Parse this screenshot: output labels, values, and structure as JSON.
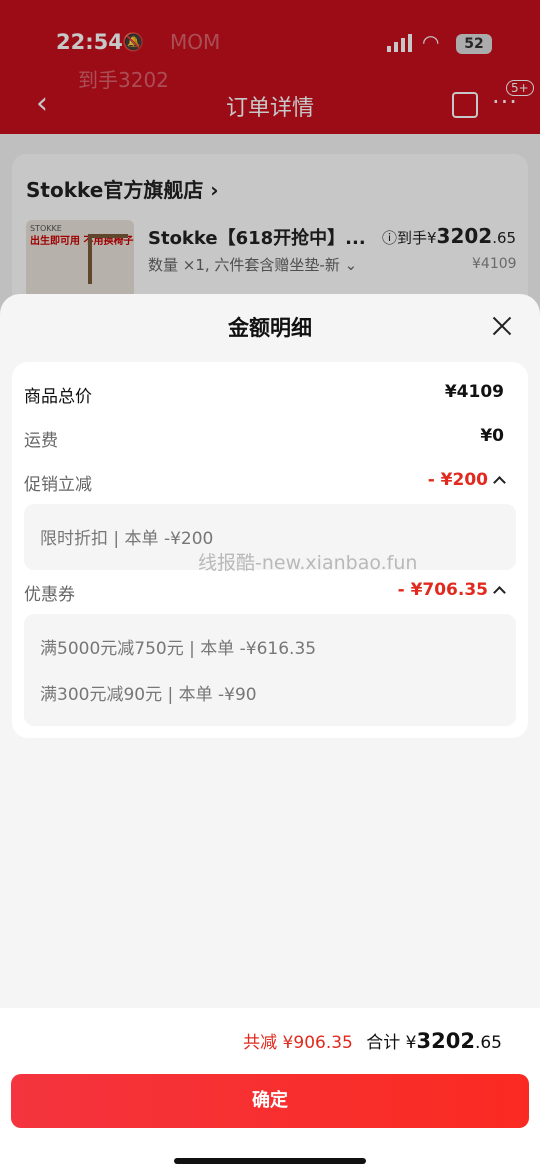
{
  "status_bar": {
    "time": "22:54",
    "battery": "52"
  },
  "nav": {
    "title": "订单详情",
    "badge": "5+",
    "bg_text_1": "MOM",
    "bg_text_2": "到手3202"
  },
  "order": {
    "store_name": "Stokke官方旗舰店",
    "thumb_brand": "STOKKE",
    "thumb_line": "出生即可用 不用换椅子",
    "product_title": "Stokke【618开抢中】...",
    "product_sub": "数量 ×1, 六件套含赠坐垫-新 ⌄",
    "final_price_label": "ⓘ到手¥",
    "final_price_int": "3202",
    "final_price_dec": ".65",
    "original_price": "¥4109"
  },
  "sheet": {
    "title": "金额明细",
    "rows": {
      "goods_total": {
        "label": "商品总价",
        "value": "¥4109"
      },
      "shipping": {
        "label": "运费",
        "value": "¥0"
      },
      "promo": {
        "label": "促销立减",
        "value": "- ¥200",
        "detail": [
          "限时折扣 | 本单 -¥200"
        ]
      },
      "coupon": {
        "label": "优惠券",
        "value": "- ¥706.35",
        "detail": [
          "满5000元减750元 | 本单 -¥616.35",
          "满300元减90元 | 本单 -¥90"
        ]
      }
    },
    "watermark": "线报酷-new.xianbao.fun"
  },
  "footer": {
    "discount_total": "共减 ¥906.35",
    "total_label": "合计 ¥",
    "total_int": "3202",
    "total_dec": ".65",
    "confirm_label": "确定"
  },
  "colors": {
    "accent_red": "#e02a1e",
    "header_red": "#c8101e"
  }
}
